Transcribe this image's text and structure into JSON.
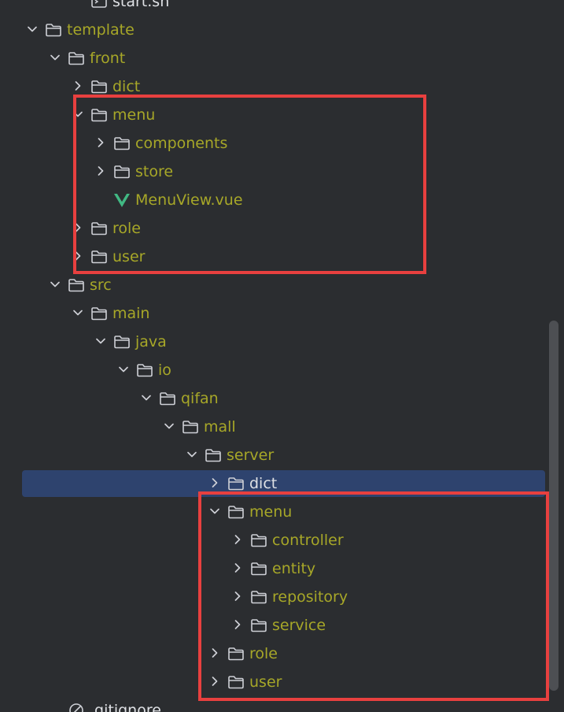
{
  "tree": {
    "rows": [
      {
        "label": "start.sh",
        "kind": "file-terminal",
        "icon": "terminal-file-icon",
        "depth": 3,
        "expanded": null,
        "plain": true
      },
      {
        "label": "template",
        "kind": "folder",
        "icon": "folder-icon",
        "depth": 1,
        "expanded": true
      },
      {
        "label": "front",
        "kind": "folder",
        "icon": "folder-icon",
        "depth": 2,
        "expanded": true
      },
      {
        "label": "dict",
        "kind": "folder",
        "icon": "folder-icon",
        "depth": 3,
        "expanded": false
      },
      {
        "label": "menu",
        "kind": "folder",
        "icon": "folder-icon",
        "depth": 3,
        "expanded": true
      },
      {
        "label": "components",
        "kind": "folder",
        "icon": "folder-icon",
        "depth": 4,
        "expanded": false
      },
      {
        "label": "store",
        "kind": "folder",
        "icon": "folder-icon",
        "depth": 4,
        "expanded": false
      },
      {
        "label": "MenuView.vue",
        "kind": "file-vue",
        "icon": "vue-file-icon",
        "depth": 4,
        "expanded": null
      },
      {
        "label": "role",
        "kind": "folder",
        "icon": "folder-icon",
        "depth": 3,
        "expanded": false
      },
      {
        "label": "user",
        "kind": "folder",
        "icon": "folder-icon",
        "depth": 3,
        "expanded": false
      },
      {
        "label": "src",
        "kind": "folder",
        "icon": "folder-icon",
        "depth": 2,
        "expanded": true
      },
      {
        "label": "main",
        "kind": "folder",
        "icon": "folder-icon",
        "depth": 3,
        "expanded": true
      },
      {
        "label": "java",
        "kind": "folder",
        "icon": "folder-icon",
        "depth": 4,
        "expanded": true
      },
      {
        "label": "io",
        "kind": "folder",
        "icon": "folder-icon",
        "depth": 5,
        "expanded": true
      },
      {
        "label": "qifan",
        "kind": "folder",
        "icon": "folder-icon",
        "depth": 6,
        "expanded": true
      },
      {
        "label": "mall",
        "kind": "folder",
        "icon": "folder-icon",
        "depth": 7,
        "expanded": true
      },
      {
        "label": "server",
        "kind": "folder",
        "icon": "folder-icon",
        "depth": 8,
        "expanded": true
      },
      {
        "label": "dict",
        "kind": "folder",
        "icon": "folder-icon",
        "depth": 9,
        "expanded": false,
        "selected": true,
        "plain": true
      },
      {
        "label": "menu",
        "kind": "folder",
        "icon": "folder-icon",
        "depth": 9,
        "expanded": true
      },
      {
        "label": "controller",
        "kind": "folder",
        "icon": "folder-icon",
        "depth": 10,
        "expanded": false
      },
      {
        "label": "entity",
        "kind": "folder",
        "icon": "folder-icon",
        "depth": 10,
        "expanded": false
      },
      {
        "label": "repository",
        "kind": "folder",
        "icon": "folder-icon",
        "depth": 10,
        "expanded": false
      },
      {
        "label": "service",
        "kind": "folder",
        "icon": "folder-icon",
        "depth": 10,
        "expanded": false
      },
      {
        "label": "role",
        "kind": "folder",
        "icon": "folder-icon",
        "depth": 9,
        "expanded": false
      },
      {
        "label": "user",
        "kind": "folder",
        "icon": "folder-icon",
        "depth": 9,
        "expanded": false
      },
      {
        "label": ".gitignore",
        "kind": "file-ignore",
        "icon": "gitignore-file-icon",
        "depth": 2,
        "expanded": null,
        "plain": true
      }
    ]
  },
  "colors": {
    "background": "#2b2d30",
    "folder_label": "#a7a728",
    "plain_label": "#dfe1e5",
    "selection": "#2e436e",
    "highlight_box": "#e8403f",
    "vue_green": "#41b883"
  }
}
